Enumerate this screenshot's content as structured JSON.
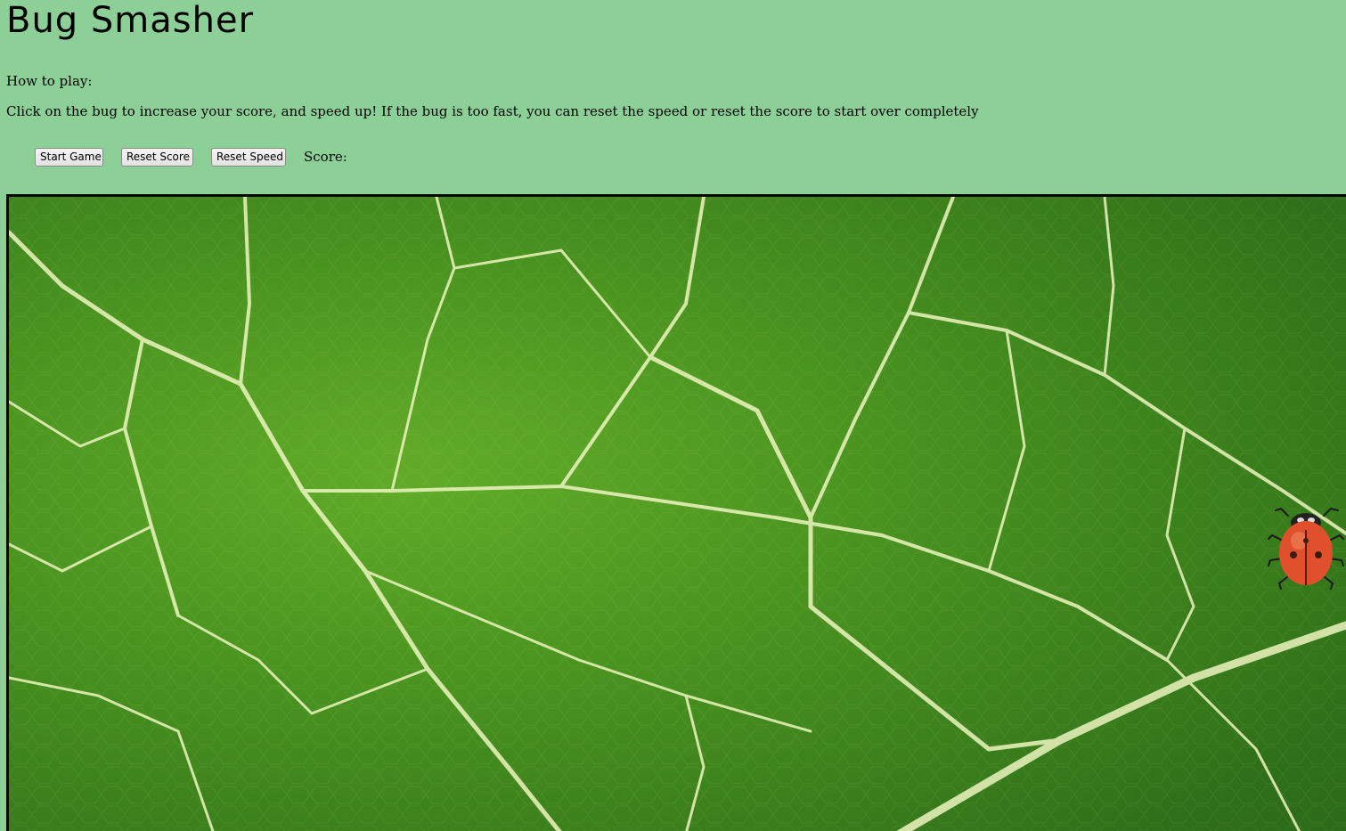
{
  "header": {
    "title": "Bug Smasher",
    "howto_label": "How to play:",
    "instructions": "Click on the bug to increase your score, and speed up! If the bug is too fast, you can reset the speed or reset the score to start over completely"
  },
  "controls": {
    "start_label": "Start Game",
    "reset_score_label": "Reset Score",
    "reset_speed_label": "Reset Speed",
    "score_label": "Score:",
    "score_value": ""
  },
  "board": {
    "background": "green-leaf-texture",
    "sprite": "ladybug-icon"
  },
  "colors": {
    "page_background": "#8ccf97",
    "leaf_green": "#4a9a1c",
    "vein": "#f2f7c8",
    "ladybug_red": "#e0502c"
  }
}
